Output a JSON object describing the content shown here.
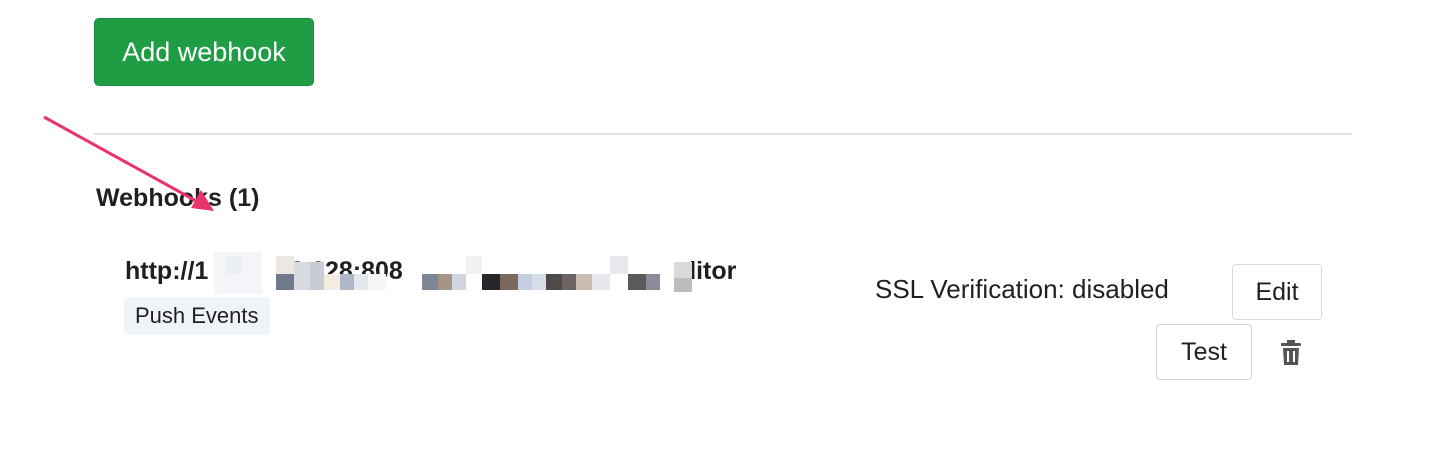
{
  "actions": {
    "add_webhook_label": "Add webhook"
  },
  "webhooks": {
    "title": "Webhooks (1)",
    "items": [
      {
        "url_prefix": "http://1",
        "url_visible_middle": "90.228:808",
        "url_suffix": "ditor",
        "events": [
          "Push Events"
        ],
        "ssl_status": "SSL Verification: disabled",
        "edit_label": "Edit",
        "test_label": "Test",
        "delete_icon": "trash-icon"
      }
    ]
  },
  "colors": {
    "primary_button": "#1f9d45",
    "annotation_arrow": "#e8336d",
    "tag_background": "#f0f3f7",
    "divider": "#e2e2e2"
  }
}
